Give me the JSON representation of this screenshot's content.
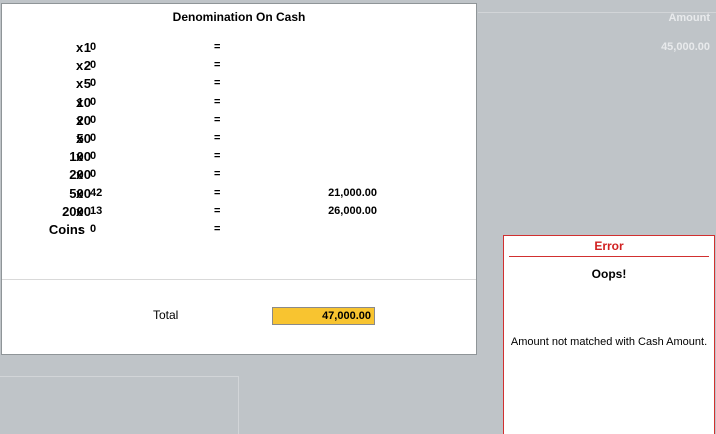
{
  "background": {
    "amount_header": "Amount",
    "amount_value": "45,000.00"
  },
  "dialog": {
    "title": "Denomination On Cash",
    "rows": [
      {
        "denom": "1",
        "mult": "x",
        "count": "0",
        "equals": "=",
        "amount": ""
      },
      {
        "denom": "2",
        "mult": "x",
        "count": "0",
        "equals": "=",
        "amount": ""
      },
      {
        "denom": "5",
        "mult": "x",
        "count": "0",
        "equals": "=",
        "amount": ""
      },
      {
        "denom": "10",
        "mult": "x",
        "count": "0",
        "equals": "=",
        "amount": ""
      },
      {
        "denom": "20",
        "mult": "x",
        "count": "0",
        "equals": "=",
        "amount": ""
      },
      {
        "denom": "50",
        "mult": "x",
        "count": "0",
        "equals": "=",
        "amount": ""
      },
      {
        "denom": "100",
        "mult": "x",
        "count": "0",
        "equals": "=",
        "amount": ""
      },
      {
        "denom": "200",
        "mult": "x",
        "count": "0",
        "equals": "=",
        "amount": ""
      },
      {
        "denom": "500",
        "mult": "x",
        "count": "42",
        "equals": "=",
        "amount": "21,000.00"
      },
      {
        "denom": "2000",
        "mult": "x",
        "count": "13",
        "equals": "=",
        "amount": "26,000.00"
      },
      {
        "denom": "Coins",
        "mult": ":",
        "count": "0",
        "equals": "=",
        "amount": ""
      }
    ],
    "total_label": "Total",
    "total_value": "47,000.00",
    "total_highlight_color": "#f8c430"
  },
  "error": {
    "title": "Error",
    "heading": "Oops!",
    "message": "Amount not matched with Cash Amount.",
    "accent_color": "#d12020"
  }
}
